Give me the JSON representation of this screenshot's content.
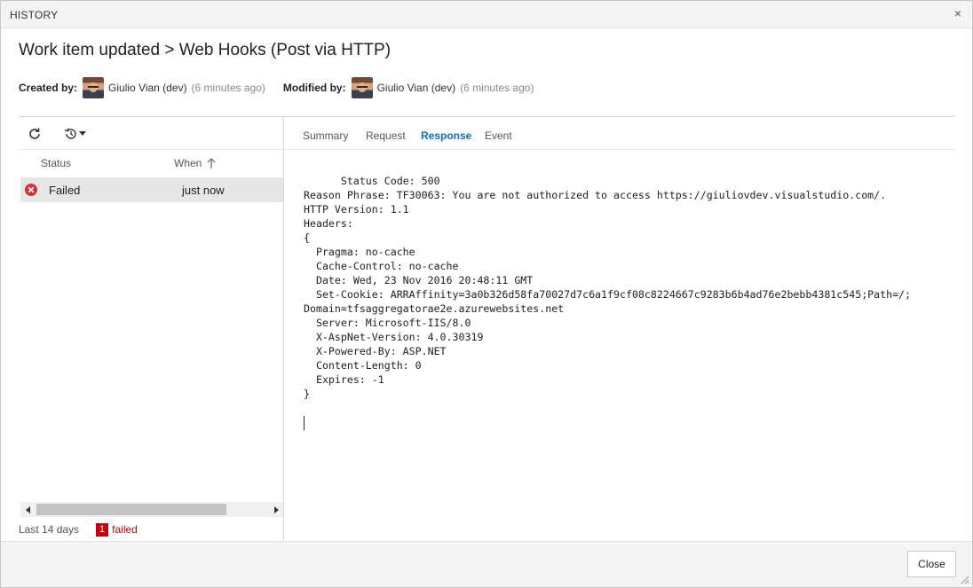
{
  "dialog": {
    "title": "HISTORY",
    "close_glyph": "×"
  },
  "header": {
    "title": "Work item updated > Web Hooks (Post via HTTP)",
    "created_label": "Created by:",
    "created_name": "Giulio Vian (dev)",
    "created_time": "(6 minutes ago)",
    "modified_label": "Modified by:",
    "modified_name": "Giulio Vian (dev)",
    "modified_time": "(6 minutes ago)"
  },
  "history_list": {
    "columns": {
      "status": "Status",
      "when": "When"
    },
    "rows": [
      {
        "status": "Failed",
        "when": "just now",
        "status_icon": "error-icon"
      }
    ],
    "footer": {
      "range": "Last 14 days",
      "failed_count": "1",
      "failed_label": "failed"
    }
  },
  "tabs": {
    "summary": "Summary",
    "request": "Request",
    "response": "Response",
    "event": "Event",
    "active": "Response"
  },
  "response": {
    "text": "Status Code: 500\nReason Phrase: TF30063: You are not authorized to access https://giuliovdev.visualstudio.com/.\nHTTP Version: 1.1\nHeaders:\n{\n  Pragma: no-cache\n  Cache-Control: no-cache\n  Date: Wed, 23 Nov 2016 20:48:11 GMT\n  Set-Cookie: ARRAffinity=3a0b326d58fa70027d7c6a1f9cf08c8224667c9283b6b4ad76e2bebb4381c545;Path=/;\nDomain=tfsaggregatorae2e.azurewebsites.net\n  Server: Microsoft-IIS/8.0\n  X-AspNet-Version: 4.0.30319\n  X-Powered-By: ASP.NET\n  Content-Length: 0\n  Expires: -1\n}"
  },
  "footer": {
    "close_label": "Close"
  },
  "colors": {
    "accent": "#106ebe",
    "error": "#c0000c",
    "selected_row": "#e6e6e6"
  }
}
